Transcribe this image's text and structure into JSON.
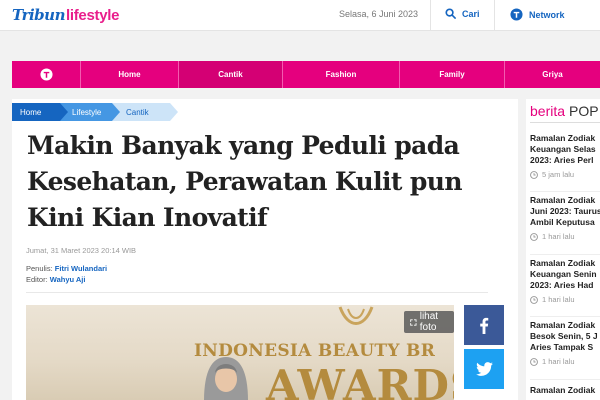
{
  "header": {
    "logo_part1": "Tribun",
    "logo_part2": "lifestyle",
    "date": "Selasa, 6 Juni 2023",
    "search_label": "Cari",
    "network_label": "Network"
  },
  "nav": {
    "items": [
      "Home",
      "Cantik",
      "Fashion",
      "Family",
      "Griya"
    ],
    "active": "Cantik"
  },
  "breadcrumb": [
    "Home",
    "Lifestyle",
    "Cantik"
  ],
  "article": {
    "title": "Makin Banyak yang Peduli pada Kesehatan, Perawatan Kulit pun Kini Kian Inovatif",
    "date": "Jumat, 31 Maret 2023 20:14 WIB",
    "writer_label": "Penulis:",
    "writer": "Fitri Wulandari",
    "editor_label": "Editor:",
    "editor": "Wahyu Aji",
    "photo_text1": "INDONESIA BEAUTY BR",
    "photo_text2": "AWARDS",
    "lihat_foto": "lihat foto"
  },
  "sidebar": {
    "heading_part1": "berita",
    "heading_part2": "POP",
    "items": [
      {
        "lines": [
          "Ramalan Zodiak",
          "Keuangan Selas",
          "2023: Aries Perl"
        ],
        "time": "5 jam lalu"
      },
      {
        "lines": [
          "Ramalan Zodiak",
          "Juni 2023: Taurus",
          "Ambil Keputusa"
        ],
        "time": "1 hari lalu"
      },
      {
        "lines": [
          "Ramalan Zodiak",
          "Keuangan Senin",
          "2023: Aries Had"
        ],
        "time": "1 hari lalu"
      },
      {
        "lines": [
          "Ramalan Zodiak",
          "Besok Senin, 5 J",
          "Aries Tampak S"
        ],
        "time": "1 hari lalu"
      },
      {
        "lines": [
          "Ramalan Zodiak"
        ],
        "time": ""
      }
    ]
  },
  "colors": {
    "brand_blue": "#1565c0",
    "brand_pink": "#e5007e",
    "facebook": "#3b5998",
    "twitter": "#1da1f2"
  },
  "icons": [
    "search-icon",
    "network-icon",
    "home-logo-icon",
    "facebook-icon",
    "twitter-icon",
    "expand-icon",
    "clock-icon"
  ]
}
